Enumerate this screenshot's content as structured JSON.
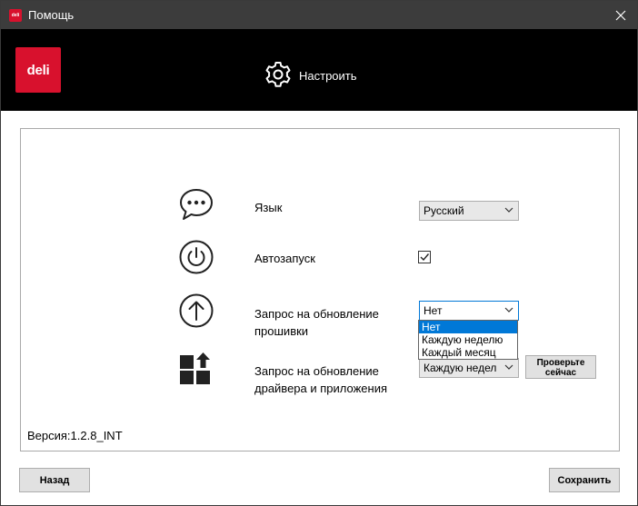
{
  "window": {
    "title": "Помощь"
  },
  "logo": {
    "text": "deli"
  },
  "header": {
    "tab_label": "Настроить"
  },
  "settings": {
    "language": {
      "label": "Язык",
      "value": "Русский"
    },
    "autostart": {
      "label": "Автозапуск",
      "checked": true
    },
    "firmware": {
      "label_line1": "Запрос на обновление",
      "label_line2": "прошивки",
      "value": "Нет",
      "options": [
        "Нет",
        "Каждую неделю",
        "Каждый месяц"
      ]
    },
    "driver": {
      "label_line1": "Запрос на обновление",
      "label_line2": "драйвера и приложения",
      "value": "Каждую недел",
      "check_now_line1": "Проверьте",
      "check_now_line2": "сейчас"
    }
  },
  "version": "Версия:1.2.8_INT",
  "footer": {
    "back_label": "Назад",
    "save_label": "Сохранить"
  },
  "colors": {
    "brand": "#d8112d",
    "selection": "#0078d7",
    "titlebar": "#3c3c3c"
  }
}
